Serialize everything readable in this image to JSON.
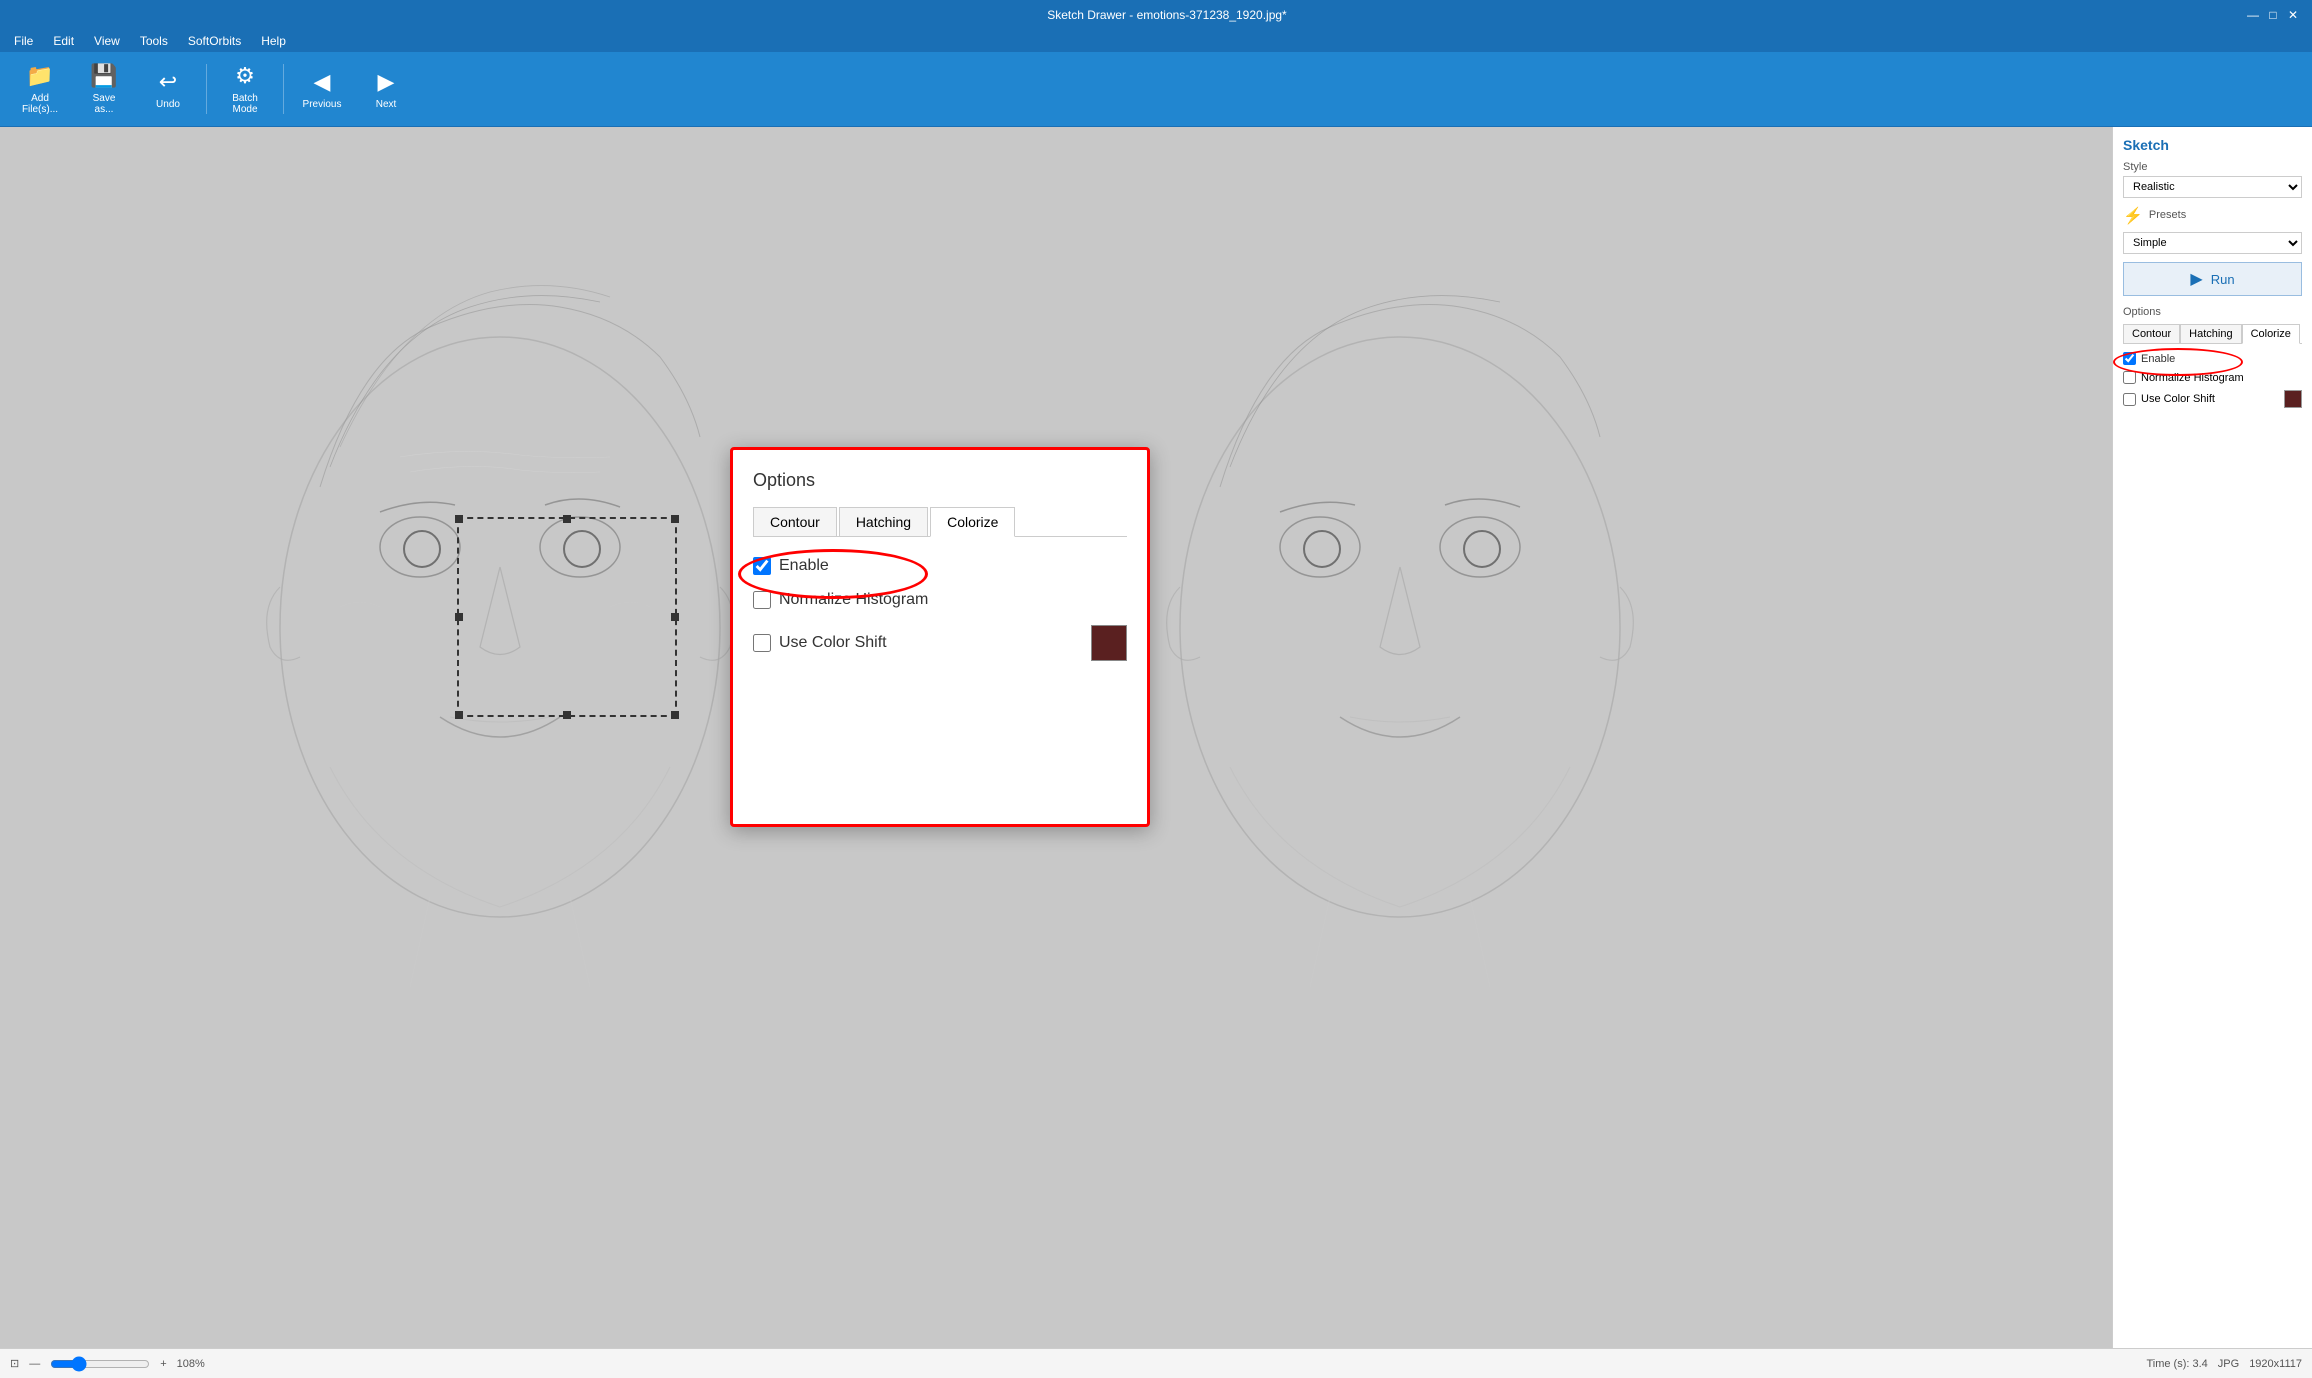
{
  "titleBar": {
    "title": "Sketch Drawer - emotions-371238_1920.jpg*",
    "minimize": "—",
    "maximize": "□",
    "close": "✕"
  },
  "menuBar": {
    "items": [
      "File",
      "Edit",
      "View",
      "Tools",
      "SoftOrbits",
      "Help"
    ]
  },
  "toolbar": {
    "addFiles": "Add\nFile(s)...",
    "saveAs": "Save\nas...",
    "undo": "Undo",
    "batchMode": "Batch\nMode",
    "previous": "Previous",
    "next": "Next"
  },
  "rightPanel": {
    "sketchLabel": "Sketch",
    "styleLabel": "Style",
    "styleValue": "Realistic",
    "presetsLabel": "Presets",
    "presetsValue": "Simple",
    "runLabel": "Run",
    "optionsLabel": "Options",
    "tabs": [
      "Contour",
      "Hatching",
      "Colorize"
    ],
    "activeTab": "Colorize",
    "enableLabel": "Enable",
    "enableChecked": true,
    "normalizeHistogramLabel": "Normalize Histogram",
    "normalizeChecked": false,
    "useColorShiftLabel": "Use Color Shift",
    "colorShiftChecked": false
  },
  "popup": {
    "title": "Options",
    "tabs": [
      "Contour",
      "Hatching",
      "Colorize"
    ],
    "activeTab": "Colorize",
    "enableLabel": "Enable",
    "enableChecked": true,
    "normalizeHistogramLabel": "Normalize Histogram",
    "normalizeChecked": false,
    "useColorShiftLabel": "Use Color Shift",
    "colorShiftChecked": false
  },
  "statusBar": {
    "zoomValue": "108%",
    "timeLabel": "Time (s): 3.4",
    "jpgLabel": "JPG",
    "dimensions": "1920x1117"
  },
  "icons": {
    "addFilesIcon": "📁",
    "saveAsIcon": "💾",
    "undoIcon": "↩",
    "batchIcon": "⚙",
    "previousIcon": "◀",
    "nextIcon": "▶",
    "runArrow": "▶",
    "presetsIcon": "⚡"
  }
}
